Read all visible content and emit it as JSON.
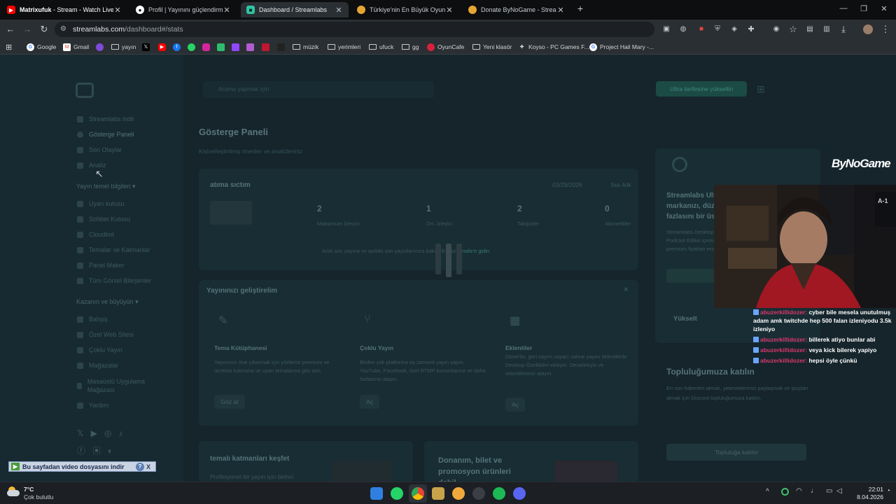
{
  "tabs": [
    {
      "title_bold": "Matrixufuk",
      "title": " - Stream - Watch Live",
      "close": "✕"
    },
    {
      "title": "Profil | Yayınını güçlendirmek iç",
      "close": "✕"
    },
    {
      "title": "Dashboard / Streamlabs",
      "close": "✕"
    },
    {
      "title": "Türkiye'nin En Büyük Oyuncu D",
      "close": "✕"
    },
    {
      "title": "Donate ByNoGame - Streamer",
      "close": "✕"
    }
  ],
  "new_tab": "+",
  "window_controls": {
    "minimize": "—",
    "restore": "❐",
    "close": "✕"
  },
  "address": {
    "host": "streamlabs.com",
    "path": "/dashboard#/stats"
  },
  "bookmarks": [
    "Google",
    "Gmail",
    "yayın",
    "müzik",
    "yerimleri",
    "ufuck",
    "gg",
    "OyunCafe",
    "Yeni klasör",
    "Koyso - PC Games F...",
    "Project Hail Mary -..."
  ],
  "streamlabs": {
    "search_placeholder": "Arama yapmak için",
    "upgrade": "Ultra tarifesine yükseltin",
    "nav": {
      "download": "Streamlabs indir",
      "dashboard": "Gösterge Paneli",
      "recent_events": "Son Olaylar",
      "analytics": "Analiz",
      "section_stream": "Yayın temel bilgileri",
      "stream_editor": "Uyarı kutusu",
      "chatbot": "Sohbet Kutusu",
      "cloudbot": "Cloudbot",
      "themes": "Temalar ve Katmanlar",
      "panel_maker": "Panel Maker",
      "all_widgets": "Tüm Görsel Bileşenler",
      "section_earn": "Kazanın ve büyüyün",
      "tips": "Bahşiş",
      "custom_site": "Özel Web Sitesi",
      "multistream": "Çoklu Yayın",
      "merch": "Mağazalar",
      "desktop_store": "Masaüstü Uygulama Mağazası",
      "help": "Yardım"
    },
    "page_title": "Gösterge Paneli",
    "page_subtitle": "Kişiselleştirilmiş öneriler ve analizleriniz",
    "last_stream": {
      "title": "atıma sıctım",
      "date": "03/29/2026",
      "duration": "3sa 4dk",
      "stats": [
        {
          "value": "2",
          "label": "Maksimum İzleyici"
        },
        {
          "value": "1",
          "label": "Ort. İzleyici"
        },
        {
          "value": "2",
          "label": "Takipçiler"
        },
        {
          "value": "0",
          "label": "Abonelikler"
        }
      ],
      "note": "Artık son yayına ve aydaki son yayınlarınıza bakabilirsiniz.",
      "note_link": "Analiz'e gidin"
    },
    "improve": {
      "title": "Yayınınızı geliştirelim",
      "cards": [
        {
          "title": "Tema Kütüphanesi",
          "text": "Yayınınızı öne çıkarmak için yüzlerce premium ve ücretsiz katmana ve uyarı temalarına göz atın.",
          "button": "Göz at"
        },
        {
          "title": "Çoklu Yayın",
          "text": "Birden çok platforma eş zamanlı yayın yapın. YouTube, Facebook, özel RTMP konumlarına ve daha fazlasına ulaşın.",
          "button": "Aç"
        },
        {
          "title": "Eklentiler",
          "text": "Dönerler, geri sayım sayacı sahne yayını eklentilerle Desktop Özellikleri ekleyin. Destekleyin ve eklentilerinizi atayın.",
          "button": "Aç"
        }
      ]
    },
    "explore": {
      "title": "temalı katmanları keşfet",
      "text": "Profesyonel bir yayın için birinci"
    },
    "hardware": {
      "title": "Donanım, bilet ve promosyon ürünleri dahil"
    },
    "promo": {
      "title": "Streamlabs Ultra",
      "text1": "markanızı, düz",
      "text2": "fazlasını bir üs",
      "desc": "Streamlabs Desktop, Podcast Editor içeren premium fiyattan erişim",
      "button": "Yükselt"
    },
    "community": {
      "title": "Topluluğumuza katılın",
      "text": "En son haberleri almak, yeteneklerinizi paylaşmak ve ipuçları almak için Discord topluluğumuza katılın.",
      "button": "Topluluğa katılın"
    }
  },
  "overlay": {
    "brand": "ByNoGame",
    "chat": [
      {
        "user": "abuzerkillidozer:",
        "text": "cyber bile mesela unutulmuş adam amk twitchde hep 500 falan izleniyodu 3.5k izleniyo"
      },
      {
        "user": "abuzerkillidozer:",
        "text": "billerek atiyo bunlar abi"
      },
      {
        "user": "abuzerkillidozer:",
        "text": "veya kick bilerek yapiyo"
      },
      {
        "user": "abuzerkillidozer:",
        "text": "hepsi öyle çünkü"
      }
    ]
  },
  "download_bar": {
    "label": "Bu sayfadan video dosyasını indir",
    "help": "?",
    "close": "X"
  },
  "taskbar": {
    "temperature": "7°C",
    "weather": "Çok bulutlu",
    "time": "22:01",
    "date": "8.04.2026"
  },
  "colors": {
    "accent": "#31c3a2",
    "chat_user": "#d9386b",
    "youtube": "#ff0000"
  }
}
